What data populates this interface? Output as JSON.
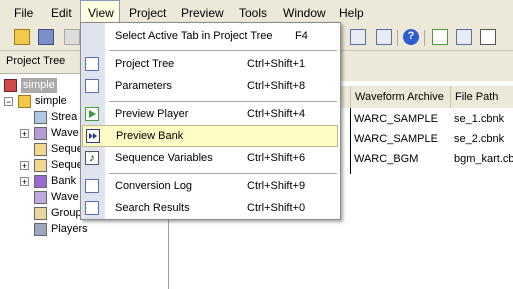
{
  "menubar": {
    "items": [
      "File",
      "Edit",
      "View",
      "Project",
      "Preview",
      "Tools",
      "Window",
      "Help"
    ],
    "active": "View"
  },
  "left_panel": {
    "title": "Project Tree",
    "tree": [
      {
        "label": "simple",
        "icon": "project-icon",
        "selected": true
      },
      {
        "label": "simple",
        "icon": "music-folder-icon"
      },
      {
        "label": "Strea",
        "icon": "stream-icon"
      },
      {
        "label": "Wave",
        "icon": "wave-icon"
      },
      {
        "label": "Seque",
        "icon": "sequence-icon"
      },
      {
        "label": "Seque",
        "icon": "sequence-set-icon"
      },
      {
        "label": "Bank",
        "icon": "bank-icon"
      },
      {
        "label": "Wave",
        "icon": "wave-archive-icon"
      },
      {
        "label": "Group",
        "icon": "group-icon"
      },
      {
        "label": "Players",
        "icon": "speaker-icon"
      }
    ]
  },
  "grid": {
    "columns": [
      "Waveform Archive",
      "File Path"
    ],
    "rows": [
      [
        "WARC_SAMPLE",
        "se_1.cbnk"
      ],
      [
        "WARC_SAMPLE",
        "se_2.cbnk"
      ],
      [
        "WARC_BGM",
        "bgm_kart.cb"
      ]
    ]
  },
  "view_menu": {
    "items": [
      {
        "label": "Select Active Tab in Project Tree",
        "shortcut": "F4",
        "icon": ""
      },
      {
        "label": "Project Tree",
        "shortcut": "Ctrl+Shift+1",
        "icon": "tree-icon"
      },
      {
        "label": "Parameters",
        "shortcut": "Ctrl+Shift+8",
        "icon": "parameters-icon"
      },
      {
        "label": "Preview Player",
        "shortcut": "Ctrl+Shift+4",
        "icon": "play-icon"
      },
      {
        "label": "Preview Bank",
        "shortcut": "",
        "icon": "bank-preview-icon",
        "highlighted": true
      },
      {
        "label": "Sequence Variables",
        "shortcut": "Ctrl+Shift+6",
        "icon": "note-icon"
      },
      {
        "label": "Conversion Log",
        "shortcut": "Ctrl+Shift+9",
        "icon": "log-icon"
      },
      {
        "label": "Search Results",
        "shortcut": "Ctrl+Shift+0",
        "icon": "search-results-icon"
      }
    ]
  }
}
